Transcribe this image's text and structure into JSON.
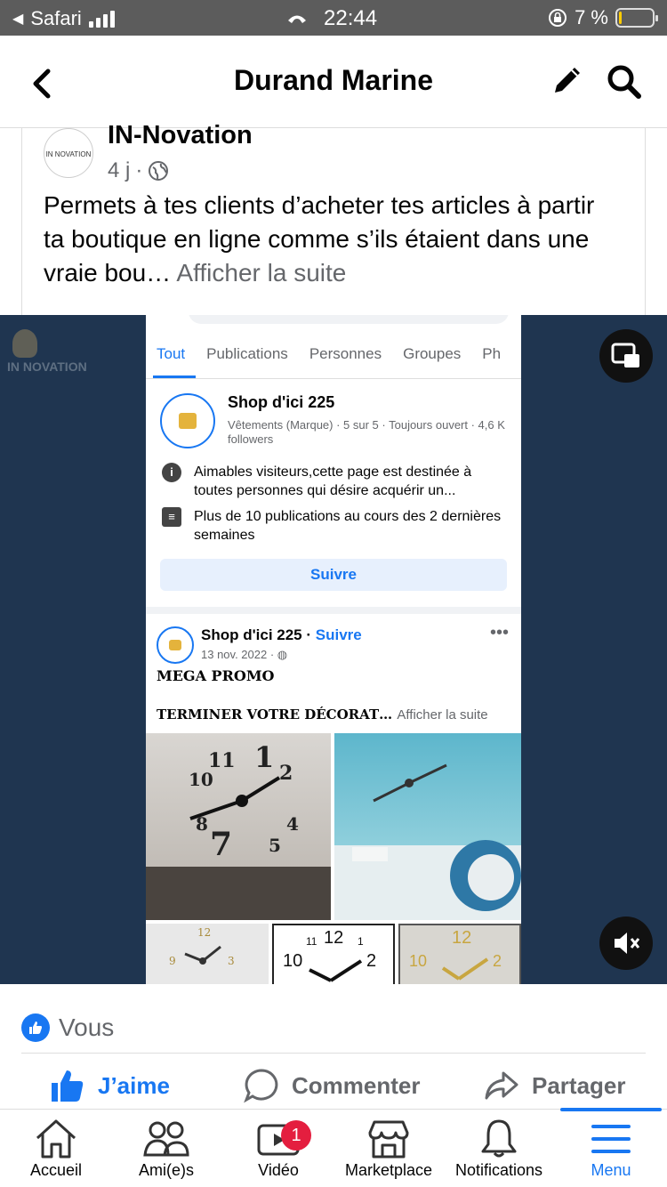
{
  "status_bar": {
    "back_app": "Safari",
    "time": "22:44",
    "battery": "7 %",
    "battery_level": 0.07
  },
  "navbar": {
    "title": "Durand Marine"
  },
  "post": {
    "author": "IN-Novation",
    "avatar_text": "IN NOVATION",
    "age": "4 j",
    "text": "Permets à tes clients d’acheter tes articles à partir ta boutique en ligne comme s’ils étaient dans une vraie bou…",
    "see_more": "Afficher la suite"
  },
  "video": {
    "brand": "IN NOVATION",
    "tabs": [
      "Tout",
      "Publications",
      "Personnes",
      "Groupes",
      "Ph"
    ],
    "page": {
      "name": "Shop d'ici 225",
      "description": "Vêtements (Marque) · 5 sur 5 · Toujours ouvert · 4,6 K followers",
      "info1": "Aimables visiteurs,cette page est destinée à toutes personnes qui désire acquérir un...",
      "info2": "Plus de 10 publications au cours des 2 dernières semaines",
      "follow": "Suivre"
    },
    "inner_post": {
      "name": "Shop d'ici 225",
      "sep": " · ",
      "follow": "Suivre",
      "date": "13 nov. 2022 · ",
      "line1": "MEGA PROMO",
      "line2": "TERMINER VOTRE DÉCORAT…",
      "see_more": "Afficher la suite"
    }
  },
  "reactions": {
    "label": "Vous"
  },
  "actions": {
    "like": "J’aime",
    "comment": "Commenter",
    "share": "Partager"
  },
  "tabbar": {
    "home": "Accueil",
    "friends": "Ami(e)s",
    "video": "Vidéo",
    "video_badge": "1",
    "marketplace": "Marketplace",
    "notifications": "Notifications",
    "menu": "Menu"
  },
  "colors": {
    "accent": "#1877f2",
    "video_bg": "#1f3550",
    "badge": "#e41e3f"
  }
}
